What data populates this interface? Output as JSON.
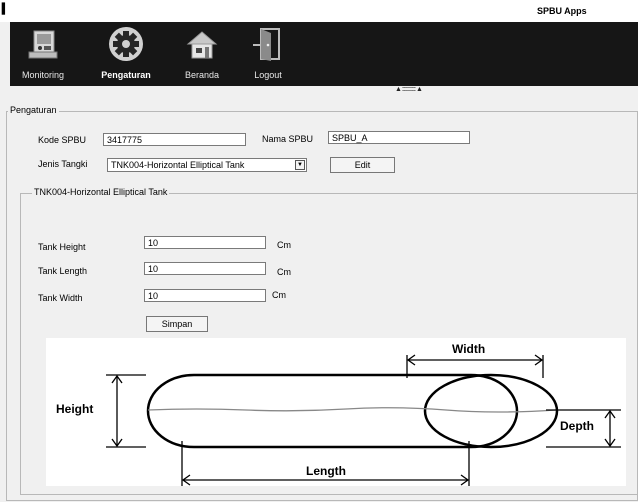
{
  "window": {
    "icon_glyph": "▍",
    "title": "SPBU Apps"
  },
  "toolbar": {
    "items": [
      {
        "label": "Monitoring",
        "icon": "monitoring-icon",
        "active": false
      },
      {
        "label": "Pengaturan",
        "icon": "gear-icon",
        "active": true
      },
      {
        "label": "Beranda",
        "icon": "home-icon",
        "active": false
      },
      {
        "label": "Logout",
        "icon": "logout-door-icon",
        "active": false
      }
    ]
  },
  "splitter": {
    "grip": "▲ :::::::::::::: ▲"
  },
  "settings": {
    "group_title": "Pengaturan",
    "kode_spbu_label": "Kode SPBU",
    "kode_spbu_value": "3417775",
    "nama_spbu_label": "Nama SPBU",
    "nama_spbu_value": "SPBU_A",
    "jenis_tangki_label": "Jenis Tangki",
    "jenis_tangki_value": "TNK004-Horizontal Elliptical Tank",
    "edit_button": "Edit"
  },
  "tank": {
    "group_title": "TNK004-Horizontal Elliptical Tank",
    "height_label": "Tank Height",
    "height_value": "10",
    "length_label": "Tank Length",
    "length_value": "10",
    "width_label": "Tank Width",
    "width_value": "10",
    "unit": "Cm",
    "save_button": "Simpan"
  },
  "diagram": {
    "height_label": "Height",
    "width_label": "Width",
    "length_label": "Length",
    "depth_label": "Depth"
  }
}
